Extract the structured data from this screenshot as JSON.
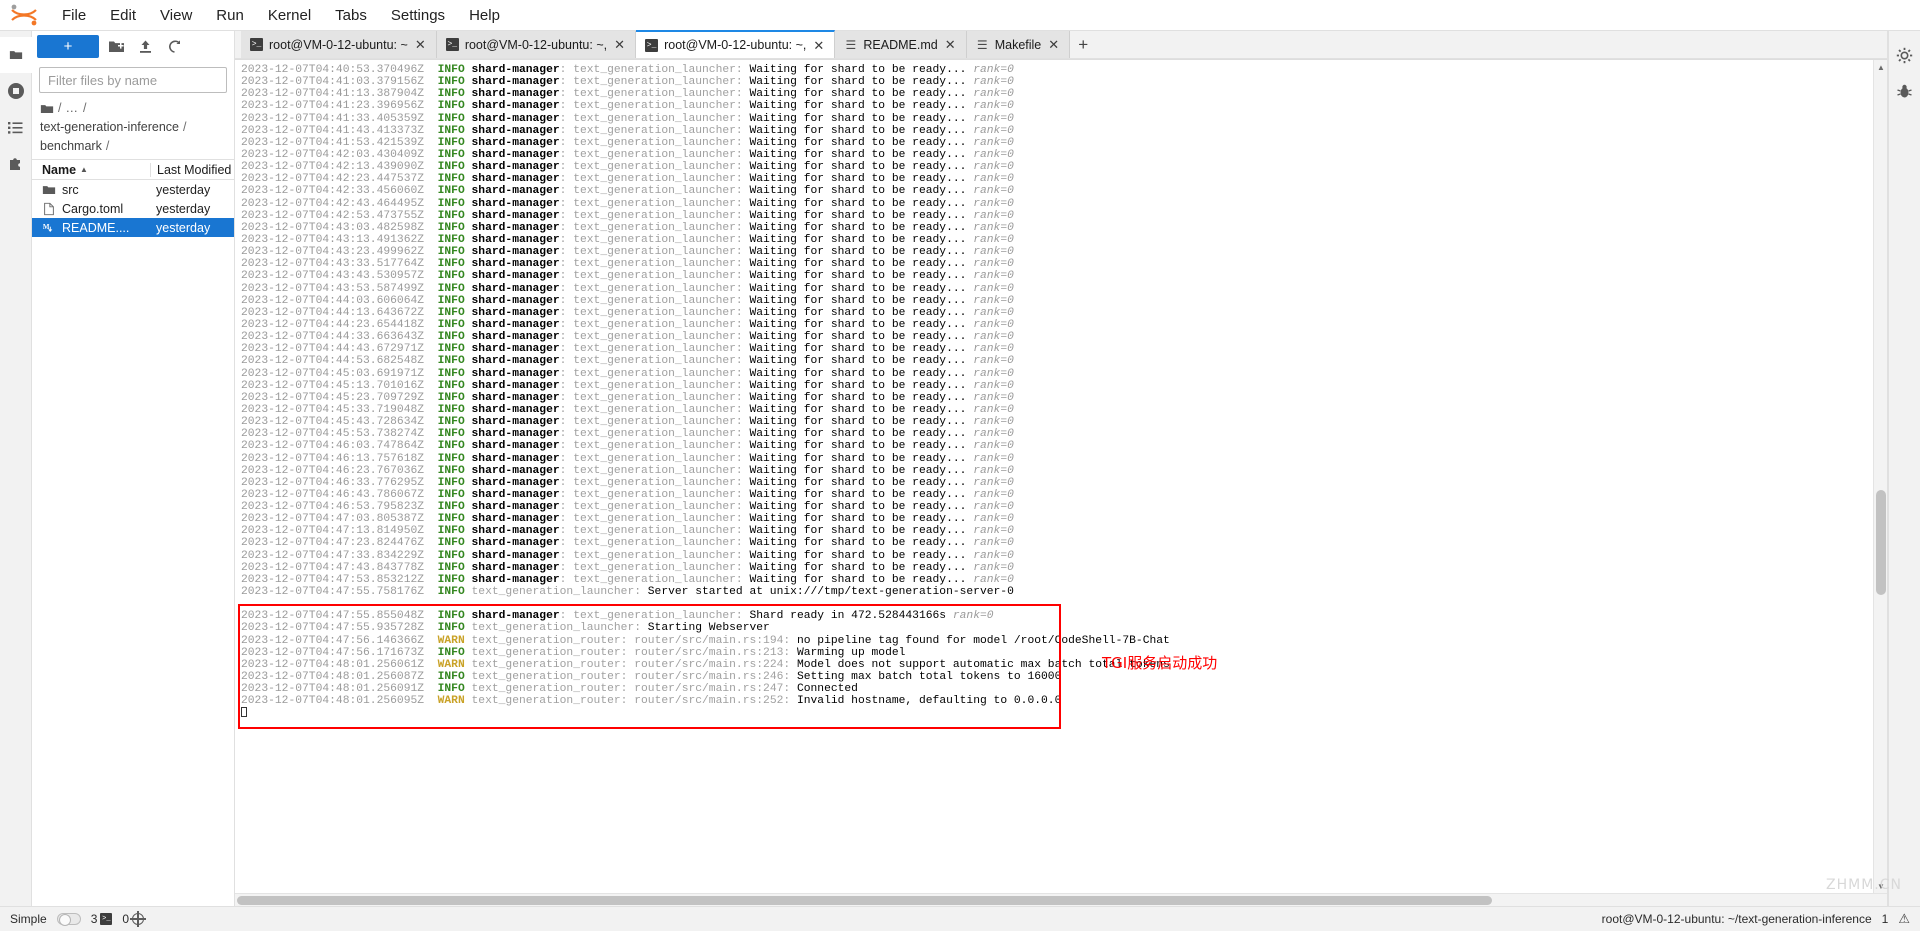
{
  "menubar": {
    "logo": "jupyter-logo",
    "items": [
      "File",
      "Edit",
      "View",
      "Run",
      "Kernel",
      "Tabs",
      "Settings",
      "Help"
    ]
  },
  "left_rail": [
    {
      "name": "file-browser-icon",
      "glyph": "folder"
    },
    {
      "name": "running-terminals-icon",
      "glyph": "stop-circle"
    },
    {
      "name": "table-of-contents-icon",
      "glyph": "list"
    },
    {
      "name": "extension-manager-icon",
      "glyph": "puzzle"
    }
  ],
  "right_rail": [
    {
      "name": "property-inspector-icon",
      "glyph": "gear"
    },
    {
      "name": "debugger-icon",
      "glyph": "bug"
    }
  ],
  "filebrowser": {
    "new_launcher_label": "+",
    "toolbar_icons": [
      "new-folder-icon",
      "upload-icon",
      "refresh-icon"
    ],
    "filter_placeholder": "Filter files by name",
    "filter_value": "",
    "search_icon": "search-icon",
    "breadcrumb": {
      "home_icon": "folder-icon",
      "root": "/",
      "ellipsis": "…",
      "segments": [
        "text-generation-inference",
        "benchmark"
      ],
      "trailing": "/"
    },
    "columns": [
      "Name",
      "Last Modified"
    ],
    "sort_indicator": "▲",
    "rows": [
      {
        "icon": "folder-icon",
        "name": "src",
        "modified": "yesterday",
        "selected": false
      },
      {
        "icon": "file-icon",
        "name": "Cargo.toml",
        "modified": "yesterday",
        "selected": false
      },
      {
        "icon": "markdown-icon",
        "name": "README....",
        "modified": "yesterday",
        "selected": true
      }
    ]
  },
  "tabs": [
    {
      "icon": "terminal-icon",
      "label": "root@VM-0-12-ubuntu: ~",
      "close": "✕",
      "current": false
    },
    {
      "icon": "terminal-icon",
      "label": "root@VM-0-12-ubuntu: ~,",
      "close": "✕",
      "current": false
    },
    {
      "icon": "terminal-icon",
      "label": "root@VM-0-12-ubuntu: ~,",
      "close": "✕",
      "current": true
    },
    {
      "icon": "markdown-icon",
      "label": "README.md",
      "close": "✕",
      "current": false
    },
    {
      "icon": "file-icon",
      "label": "Makefile",
      "close": "✕",
      "current": false
    }
  ],
  "tab_add_label": "+",
  "terminal": {
    "waiting_lines": [
      "2023-12-07T04:40:53.370496Z",
      "2023-12-07T04:41:03.379156Z",
      "2023-12-07T04:41:13.387904Z",
      "2023-12-07T04:41:23.396956Z",
      "2023-12-07T04:41:33.405359Z",
      "2023-12-07T04:41:43.413373Z",
      "2023-12-07T04:41:53.421539Z",
      "2023-12-07T04:42:03.430409Z",
      "2023-12-07T04:42:13.439090Z",
      "2023-12-07T04:42:23.447537Z",
      "2023-12-07T04:42:33.456060Z",
      "2023-12-07T04:42:43.464495Z",
      "2023-12-07T04:42:53.473755Z",
      "2023-12-07T04:43:03.482598Z",
      "2023-12-07T04:43:13.491362Z",
      "2023-12-07T04:43:23.499962Z",
      "2023-12-07T04:43:33.517764Z",
      "2023-12-07T04:43:43.530957Z",
      "2023-12-07T04:43:53.587499Z",
      "2023-12-07T04:44:03.606064Z",
      "2023-12-07T04:44:13.643672Z",
      "2023-12-07T04:44:23.654418Z",
      "2023-12-07T04:44:33.663643Z",
      "2023-12-07T04:44:43.672971Z",
      "2023-12-07T04:44:53.682548Z",
      "2023-12-07T04:45:03.691971Z",
      "2023-12-07T04:45:13.701016Z",
      "2023-12-07T04:45:23.709729Z",
      "2023-12-07T04:45:33.719048Z",
      "2023-12-07T04:45:43.728634Z",
      "2023-12-07T04:45:53.738274Z",
      "2023-12-07T04:46:03.747864Z",
      "2023-12-07T04:46:13.757618Z",
      "2023-12-07T04:46:23.767036Z",
      "2023-12-07T04:46:33.776295Z",
      "2023-12-07T04:46:43.786067Z",
      "2023-12-07T04:46:53.795823Z",
      "2023-12-07T04:47:03.805387Z",
      "2023-12-07T04:47:13.814950Z",
      "2023-12-07T04:47:23.824476Z",
      "2023-12-07T04:47:33.834229Z",
      "2023-12-07T04:47:43.843778Z",
      "2023-12-07T04:47:53.853212Z"
    ],
    "waiting_level": "INFO",
    "waiting_target": "shard-manager",
    "waiting_module": "text_generation_launcher",
    "waiting_message": "Waiting for shard to be ready...",
    "waiting_rank": "rank=0",
    "server_started": {
      "ts": "2023-12-07T04:47:55.758176Z",
      "level": "INFO",
      "module": "text_generation_launcher",
      "message": "Server started at unix:///tmp/text-generation-server-0"
    },
    "highlight_lines": [
      {
        "ts": "2023-12-07T04:47:55.855048Z",
        "level": "INFO",
        "target": "shard-manager",
        "module": "text_generation_launcher",
        "message": "Shard ready in 472.528443166s",
        "rank": "rank=0"
      },
      {
        "ts": "2023-12-07T04:47:55.935728Z",
        "level": "INFO",
        "target": "",
        "module": "text_generation_launcher",
        "message": "Starting Webserver",
        "rank": ""
      },
      {
        "ts": "2023-12-07T04:47:56.146366Z",
        "level": "WARN",
        "target": "",
        "module": "text_generation_router",
        "source": "router/src/main.rs:194",
        "message": "no pipeline tag found for model /root/CodeShell-7B-Chat",
        "rank": ""
      },
      {
        "ts": "2023-12-07T04:47:56.171673Z",
        "level": "INFO",
        "target": "",
        "module": "text_generation_router",
        "source": "router/src/main.rs:213",
        "message": "Warming up model",
        "rank": ""
      },
      {
        "ts": "2023-12-07T04:48:01.256061Z",
        "level": "WARN",
        "target": "",
        "module": "text_generation_router",
        "source": "router/src/main.rs:224",
        "message": "Model does not support automatic max batch total tokens",
        "rank": ""
      },
      {
        "ts": "2023-12-07T04:48:01.256087Z",
        "level": "INFO",
        "target": "",
        "module": "text_generation_router",
        "source": "router/src/main.rs:246",
        "message": "Setting max batch total tokens to 16000",
        "rank": ""
      },
      {
        "ts": "2023-12-07T04:48:01.256091Z",
        "level": "INFO",
        "target": "",
        "module": "text_generation_router",
        "source": "router/src/main.rs:247",
        "message": "Connected",
        "rank": ""
      },
      {
        "ts": "2023-12-07T04:48:01.256095Z",
        "level": "WARN",
        "target": "",
        "module": "text_generation_router",
        "source": "router/src/main.rs:252",
        "message": "Invalid hostname, defaulting to 0.0.0.0",
        "rank": ""
      }
    ]
  },
  "annotation": {
    "text": "TGI服务启动成功",
    "color": "#ff0000"
  },
  "statusbar": {
    "mode_label": "Simple",
    "terminal_count": "3",
    "terminal_icon": "terminal-icon",
    "kernel_count": "0",
    "kernel_icon": "kernel-icon",
    "session_path": "root@VM-0-12-ubuntu: ~/text-generation-inference",
    "notification_count": "1",
    "notification_icon": "warning-icon"
  },
  "watermark": "ZHMM.CN",
  "colors": {
    "accent": "#1976d2",
    "info": "#33861f",
    "warn": "#c9a227",
    "annotation": "#ff0000",
    "selection": "#1976d2"
  }
}
